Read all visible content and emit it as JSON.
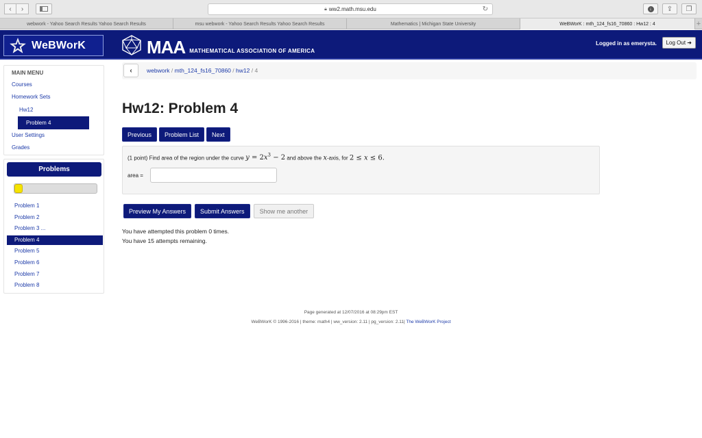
{
  "browser": {
    "url": "ww2.math.msu.edu",
    "tabs": [
      "webwork - Yahoo Search Results Yahoo Search Results",
      "msu webwork - Yahoo Search Results Yahoo Search Results",
      "Mathematics | Michigan State University",
      "WeBWorK : mth_124_fs16_70860 : Hw12 : 4"
    ],
    "active_tab_index": 3
  },
  "header": {
    "logo_text": "WeBWorK",
    "maa_title": "MAA",
    "maa_subtitle": "MATHEMATICAL ASSOCIATION OF AMERICA",
    "login_status": "Logged in as emerysta.",
    "logout_label": "Log Out ➜"
  },
  "main_menu": {
    "title": "MAIN MENU",
    "courses": "Courses",
    "homework_sets": "Homework Sets",
    "hw": "Hw12",
    "current_problem": "Problem 4",
    "user_settings": "User Settings",
    "grades": "Grades"
  },
  "problems_panel": {
    "title": "Problems",
    "progress_fraction": 0.1,
    "items": [
      "Problem 1",
      "Problem 2",
      "Problem 3 ...",
      "Problem 4",
      "Problem 5",
      "Problem 6",
      "Problem 7",
      "Problem 8"
    ],
    "current_index": 3
  },
  "breadcrumb": {
    "root": "webwork",
    "course": "mth_124_fs16_70860",
    "set": "hw12",
    "problem": "4"
  },
  "page_title": "Hw12: Problem 4",
  "nav_buttons": {
    "previous": "Previous",
    "list": "Problem List",
    "next": "Next"
  },
  "question": {
    "intro": "(1 point) Find area of the region under the curve",
    "mid": "and above the",
    "axis_word": "-axis, for",
    "answer_label": "area =",
    "answer_value": ""
  },
  "actions": {
    "preview": "Preview My Answers",
    "submit": "Submit Answers",
    "another": "Show me another"
  },
  "attempts": {
    "line1": "You have attempted this problem 0 times.",
    "line2": "You have 15 attempts remaining."
  },
  "footer": {
    "generated": "Page generated at 12/07/2016 at 08:29pm EST",
    "versions": "WeBWorK © 1996-2016 | theme: math4 | ww_version: 2.11 | pg_version: 2.11|",
    "project": "The WeBWorK Project"
  },
  "colors": {
    "brand_navy": "#0d1a7a",
    "link_blue": "#1c3aa8",
    "progress_yellow": "#f5e400"
  }
}
